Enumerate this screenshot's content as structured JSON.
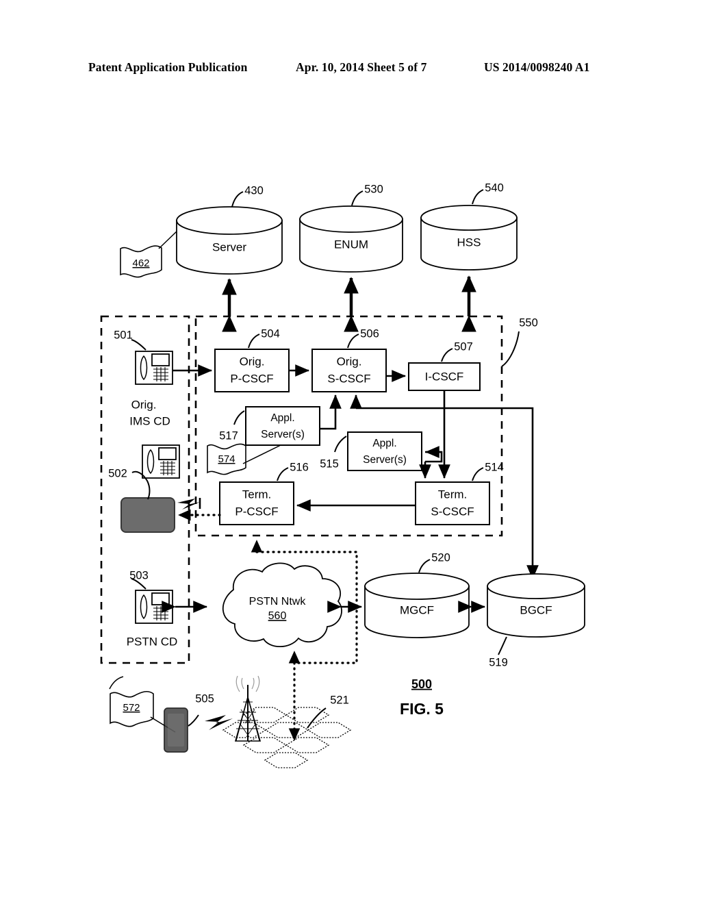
{
  "header": {
    "publication": "Patent Application Publication",
    "date_sheet": "Apr. 10, 2014  Sheet 5 of 7",
    "patent_number": "US 2014/0098240 A1"
  },
  "figure": {
    "caption": "FIG. 5",
    "figure_ref": "500"
  },
  "databases": [
    {
      "id": "server",
      "label": "Server",
      "ref": "430"
    },
    {
      "id": "enum",
      "label": "ENUM",
      "ref": "530"
    },
    {
      "id": "hss",
      "label": "HSS",
      "ref": "540"
    },
    {
      "id": "mgcf",
      "label": "MGCF",
      "ref": "520"
    },
    {
      "id": "bgcf",
      "label": "BGCF",
      "ref": "519"
    }
  ],
  "boxes": [
    {
      "id": "orig_pcscf",
      "line1": "Orig.",
      "line2": "P-CSCF",
      "ref": "504"
    },
    {
      "id": "orig_scscf",
      "line1": "Orig.",
      "line2": "S-CSCF",
      "ref": "506"
    },
    {
      "id": "icscf",
      "line1": "I-CSCF",
      "line2": "",
      "ref": "507"
    },
    {
      "id": "appl_517",
      "line1": "Appl.",
      "line2": "Server(s)",
      "ref": "517"
    },
    {
      "id": "appl_515",
      "line1": "Appl.",
      "line2": "Server(s)",
      "ref": "515"
    },
    {
      "id": "term_pcscf",
      "line1": "Term.",
      "line2": "P-CSCF",
      "ref": "516"
    },
    {
      "id": "term_scscf",
      "line1": "Term.",
      "line2": "S-CSCF",
      "ref": "514"
    }
  ],
  "devices": [
    {
      "id": "orig_ims_cd",
      "ref": "501",
      "caption_line1": "Orig.",
      "caption_line2": "IMS CD"
    },
    {
      "id": "second_cd",
      "ref": "502",
      "caption_line1": "",
      "caption_line2": ""
    },
    {
      "id": "pstn_cd",
      "ref": "503",
      "caption_line1": "PSTN CD",
      "caption_line2": ""
    },
    {
      "id": "mobile_cd",
      "ref": "505",
      "caption_line1": "",
      "caption_line2": ""
    },
    {
      "id": "cell_network",
      "ref": "521",
      "caption_line1": "",
      "caption_line2": ""
    }
  ],
  "cloud": {
    "label": "PSTN Ntwk",
    "ref": "560"
  },
  "group_labels": {
    "ims_network_ref": "550"
  },
  "flags": [
    {
      "id": "flag_462",
      "ref": "462"
    },
    {
      "id": "flag_574",
      "ref": "574"
    },
    {
      "id": "flag_572",
      "ref": "572"
    }
  ],
  "colors": {
    "stroke": "#000000",
    "background": "#ffffff"
  }
}
